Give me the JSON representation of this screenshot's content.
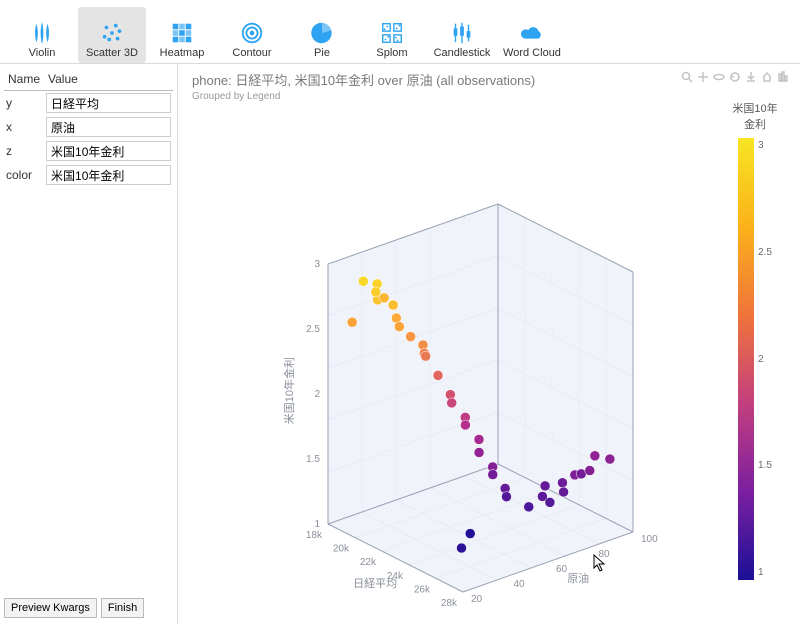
{
  "toolbar": [
    {
      "label": "Violin",
      "icon": "violin",
      "selected": false
    },
    {
      "label": "Scatter 3D",
      "icon": "scatter3d",
      "selected": true
    },
    {
      "label": "Heatmap",
      "icon": "heatmap",
      "selected": false
    },
    {
      "label": "Contour",
      "icon": "contour",
      "selected": false
    },
    {
      "label": "Pie",
      "icon": "pie",
      "selected": false
    },
    {
      "label": "Splom",
      "icon": "splom",
      "selected": false
    },
    {
      "label": "Candlestick",
      "icon": "candlestick",
      "selected": false
    },
    {
      "label": "Word Cloud",
      "icon": "wordcloud",
      "selected": false
    }
  ],
  "sidebar": {
    "header_name": "Name",
    "header_value": "Value",
    "rows": [
      {
        "name": "y",
        "value": "日経平均"
      },
      {
        "name": "x",
        "value": "原油"
      },
      {
        "name": "z",
        "value": "米国10年金利"
      },
      {
        "name": "color",
        "value": "米国10年金利"
      }
    ],
    "preview_btn": "Preview Kwargs",
    "finish_btn": "Finish"
  },
  "chart": {
    "title": "phone: 日経平均, 米国10年金利  over 原油 (all observations)",
    "subtitle": "Grouped by Legend",
    "colorbar_title": "米国10年金利",
    "colorbar_ticks": [
      "3",
      "2.5",
      "2",
      "1.5",
      "1"
    ],
    "axis_x": "日経平均",
    "axis_y": "原油",
    "axis_z": "米国10年金利",
    "x_ticks": [
      "18k",
      "20k",
      "22k",
      "24k",
      "26k",
      "28k"
    ],
    "y_ticks": [
      "20",
      "40",
      "60",
      "80",
      "100"
    ],
    "z_ticks": [
      "1",
      "1.5",
      "2",
      "2.5",
      "3"
    ]
  },
  "chart_data": {
    "type": "scatter3d",
    "xlabel": "日経平均",
    "ylabel": "原油",
    "zlabel": "米国10年金利",
    "colorlabel": "米国10年金利",
    "x_range": [
      18000,
      29000
    ],
    "y_range": [
      15,
      105
    ],
    "z_range": [
      0.8,
      3.2
    ],
    "color_range": [
      0.8,
      3.2
    ],
    "points": [
      {
        "x": 19800,
        "y": 22,
        "z": 3.1,
        "c": 3.1
      },
      {
        "x": 20500,
        "y": 25,
        "z": 2.95,
        "c": 2.95
      },
      {
        "x": 20000,
        "y": 28,
        "z": 3.05,
        "c": 3.05
      },
      {
        "x": 21000,
        "y": 30,
        "z": 2.9,
        "c": 2.9
      },
      {
        "x": 20800,
        "y": 33,
        "z": 2.75,
        "c": 2.75
      },
      {
        "x": 19500,
        "y": 35,
        "z": 2.85,
        "c": 2.85
      },
      {
        "x": 21500,
        "y": 36,
        "z": 2.6,
        "c": 2.6
      },
      {
        "x": 22200,
        "y": 38,
        "z": 2.55,
        "c": 2.55
      },
      {
        "x": 22000,
        "y": 40,
        "z": 2.45,
        "c": 2.45
      },
      {
        "x": 21800,
        "y": 42,
        "z": 2.4,
        "c": 2.4
      },
      {
        "x": 22500,
        "y": 44,
        "z": 2.25,
        "c": 2.25
      },
      {
        "x": 23200,
        "y": 46,
        "z": 2.1,
        "c": 2.1
      },
      {
        "x": 23000,
        "y": 48,
        "z": 2.0,
        "c": 2.0
      },
      {
        "x": 23800,
        "y": 50,
        "z": 1.9,
        "c": 1.9
      },
      {
        "x": 23500,
        "y": 52,
        "z": 1.8,
        "c": 1.8
      },
      {
        "x": 24300,
        "y": 54,
        "z": 1.7,
        "c": 1.7
      },
      {
        "x": 24000,
        "y": 56,
        "z": 1.55,
        "c": 1.55
      },
      {
        "x": 24800,
        "y": 58,
        "z": 1.45,
        "c": 1.45
      },
      {
        "x": 24500,
        "y": 60,
        "z": 1.35,
        "c": 1.35
      },
      {
        "x": 25200,
        "y": 62,
        "z": 1.25,
        "c": 1.25
      },
      {
        "x": 25000,
        "y": 64,
        "z": 1.15,
        "c": 1.15
      },
      {
        "x": 25800,
        "y": 35,
        "z": 0.9,
        "c": 0.9
      },
      {
        "x": 24200,
        "y": 50,
        "z": 0.85,
        "c": 0.85
      },
      {
        "x": 26200,
        "y": 68,
        "z": 1.1,
        "c": 1.1
      },
      {
        "x": 26300,
        "y": 76,
        "z": 1.25,
        "c": 1.25
      },
      {
        "x": 26700,
        "y": 72,
        "z": 1.2,
        "c": 1.2
      },
      {
        "x": 27000,
        "y": 74,
        "z": 1.15,
        "c": 1.15
      },
      {
        "x": 27100,
        "y": 80,
        "z": 1.3,
        "c": 1.3
      },
      {
        "x": 27500,
        "y": 78,
        "z": 1.25,
        "c": 1.25
      },
      {
        "x": 27800,
        "y": 82,
        "z": 1.4,
        "c": 1.4
      },
      {
        "x": 27400,
        "y": 88,
        "z": 1.35,
        "c": 1.35
      },
      {
        "x": 28400,
        "y": 86,
        "z": 1.45,
        "c": 1.45
      },
      {
        "x": 28200,
        "y": 90,
        "z": 1.55,
        "c": 1.55
      },
      {
        "x": 28500,
        "y": 96,
        "z": 1.5,
        "c": 1.5
      },
      {
        "x": 19200,
        "y": 20,
        "z": 2.7,
        "c": 2.7
      },
      {
        "x": 21200,
        "y": 32,
        "z": 2.7,
        "c": 2.7
      },
      {
        "x": 20200,
        "y": 26,
        "z": 3.0,
        "c": 3.0
      }
    ]
  }
}
